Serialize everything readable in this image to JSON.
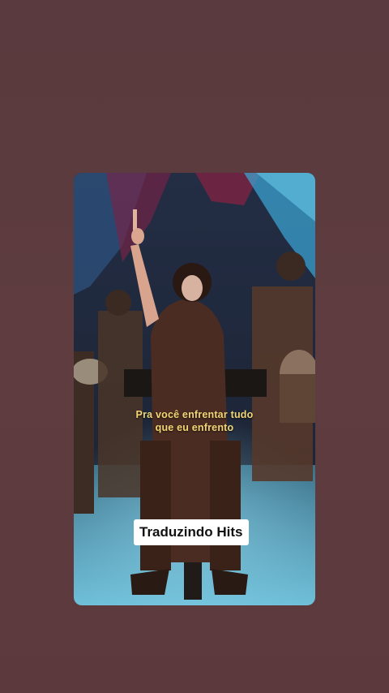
{
  "video": {
    "subtitle_line1": "Pra você enfrentar tudo",
    "subtitle_line2": "que eu enfrento",
    "brand_label": "Traduzindo Hits"
  },
  "colors": {
    "background": "#5c3b3f",
    "subtitle": "#f2d675",
    "brand_bg": "#ffffff",
    "brand_text": "#111111"
  }
}
